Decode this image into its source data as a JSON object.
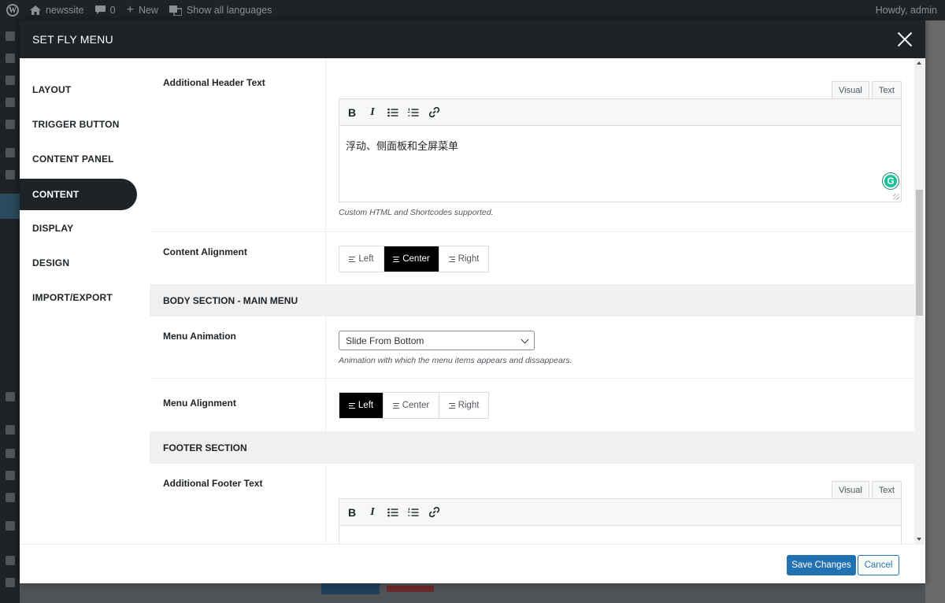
{
  "admin_bar": {
    "site_name": "newssite",
    "comments_count": "0",
    "new_label": "New",
    "languages_label": "Show all languages",
    "howdy": "Howdy, admin"
  },
  "modal": {
    "title": "SET FLY MENU"
  },
  "sidebar": {
    "items": [
      {
        "label": "LAYOUT"
      },
      {
        "label": "TRIGGER BUTTON"
      },
      {
        "label": "CONTENT PANEL"
      },
      {
        "label": "CONTENT",
        "active": true
      },
      {
        "label": "DISPLAY"
      },
      {
        "label": "DESIGN"
      },
      {
        "label": "IMPORT/EXPORT"
      }
    ]
  },
  "header_text": {
    "label": "Additional Header Text",
    "tab_visual": "Visual",
    "tab_text": "Text",
    "content": "浮动、侧面板和全屏菜单",
    "help": "Custom HTML and Shortcodes supported."
  },
  "content_alignment": {
    "label": "Content Alignment",
    "options": [
      "Left",
      "Center",
      "Right"
    ],
    "selected": "Center"
  },
  "body_section": {
    "heading": "BODY SECTION - MAIN MENU"
  },
  "menu_animation": {
    "label": "Menu Animation",
    "value": "Slide From Bottom",
    "help": "Animation with which the menu items appears and dissappears."
  },
  "menu_alignment": {
    "label": "Menu Alignment",
    "options": [
      "Left",
      "Center",
      "Right"
    ],
    "selected": "Left"
  },
  "footer_section": {
    "heading": "FOOTER SECTION"
  },
  "footer_text": {
    "label": "Additional Footer Text",
    "tab_visual": "Visual",
    "tab_text": "Text"
  },
  "toolbar": {
    "bold": "B",
    "italic": "I"
  },
  "actions": {
    "save": "Save Changes",
    "cancel": "Cancel"
  },
  "colors": {
    "header_bg": "#1d2327",
    "primary": "#2271b1",
    "selected_toggle": "#000000",
    "grammarly": "#15c39a"
  }
}
